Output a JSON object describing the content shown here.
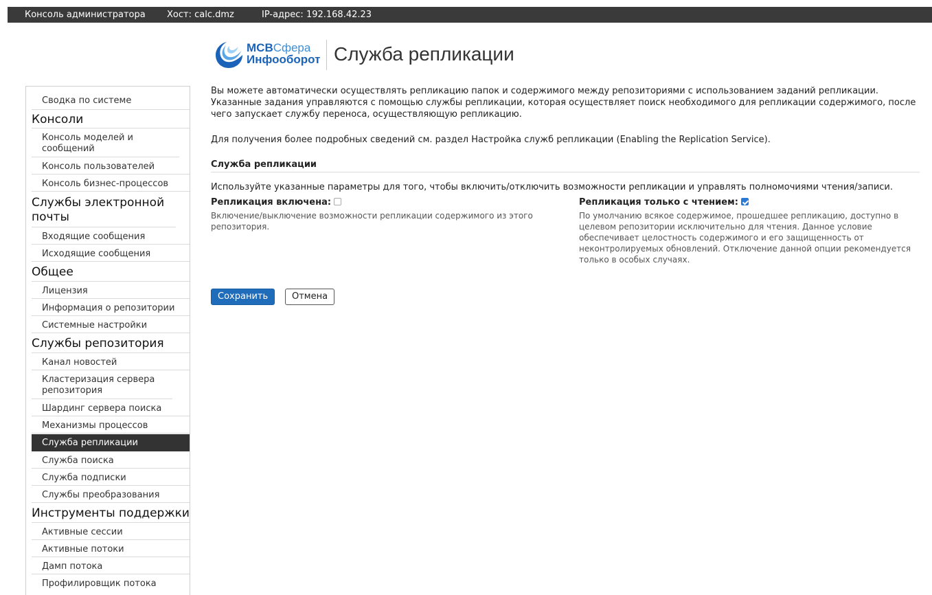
{
  "topbar": {
    "console": "Консоль администратора",
    "host": "Хост: calc.dmz",
    "ip": "IP-адрес: 192.168.42.23"
  },
  "brand": {
    "logo_line1_bold": "МСВ",
    "logo_line1_thin": "Сфера",
    "logo_line2": "Инфооборот",
    "page_title": "Служба репликации",
    "accent_color": "#1a63b8"
  },
  "sidebar": {
    "items": [
      {
        "type": "item",
        "label": "Сводка по системе"
      },
      {
        "type": "group",
        "label": "Консоли"
      },
      {
        "type": "item",
        "label": "Консоль моделей и сообщений"
      },
      {
        "type": "item",
        "label": "Консоль пользователей"
      },
      {
        "type": "item",
        "label": "Консоль бизнес-процессов"
      },
      {
        "type": "group",
        "label": "Службы электронной почты"
      },
      {
        "type": "item",
        "label": "Входящие сообщения"
      },
      {
        "type": "item",
        "label": "Исходящие сообщения"
      },
      {
        "type": "group",
        "label": "Общее"
      },
      {
        "type": "item",
        "label": "Лицензия"
      },
      {
        "type": "item",
        "label": "Информация о репозитории"
      },
      {
        "type": "item",
        "label": "Системные настройки"
      },
      {
        "type": "group",
        "label": "Службы репозитория"
      },
      {
        "type": "item",
        "label": "Канал новостей"
      },
      {
        "type": "item",
        "label": "Кластеризация сервера репозитория"
      },
      {
        "type": "item",
        "label": "Шардинг сервера поиска"
      },
      {
        "type": "item",
        "label": "Механизмы процессов"
      },
      {
        "type": "item",
        "label": "Служба репликации",
        "active": true
      },
      {
        "type": "item",
        "label": "Служба поиска"
      },
      {
        "type": "item",
        "label": "Служба подписки"
      },
      {
        "type": "item",
        "label": "Службы преобразования"
      },
      {
        "type": "group",
        "label": "Инструменты поддержки"
      },
      {
        "type": "item",
        "label": "Активные сессии"
      },
      {
        "type": "item",
        "label": "Активные потоки"
      },
      {
        "type": "item",
        "label": "Дамп потока"
      },
      {
        "type": "item",
        "label": "Профилировщик потока"
      }
    ]
  },
  "content": {
    "intro": "Вы можете автоматически осуществлять репликацию папок и содержимого между репозиториями с использованием заданий репликации. Указанные задания управляются с помощью службы репликации, которая осуществляет поиск необходимого для репликации содержимого, после чего запускает службу переноса, осуществляющую репликацию.",
    "more_info": "Для получения более подробных сведений см. раздел Настройка служб репликации (Enabling the Replication Service).",
    "section_title": "Служба репликации",
    "section_desc": "Используйте указанные параметры для того, чтобы включить/отключить возможности репликации и управлять полномочиями чтения/записи.",
    "replication_enabled": {
      "label": "Репликация включена:",
      "checked": false,
      "desc": "Включение/выключение возможности репликации содержимого из этого репозитория."
    },
    "read_only": {
      "label": "Репликация только с чтением:",
      "checked": true,
      "desc": "По умолчанию всякое содержимое, прошедшее репликацию, доступно в целевом репозитории исключительно для чтения. Данное условие обеспечивает целостность содержимого и его защищенность от неконтролируемых обновлений. Отключение данной опции рекомендуется только в особых случаях."
    },
    "save_label": "Сохранить",
    "cancel_label": "Отмена"
  }
}
